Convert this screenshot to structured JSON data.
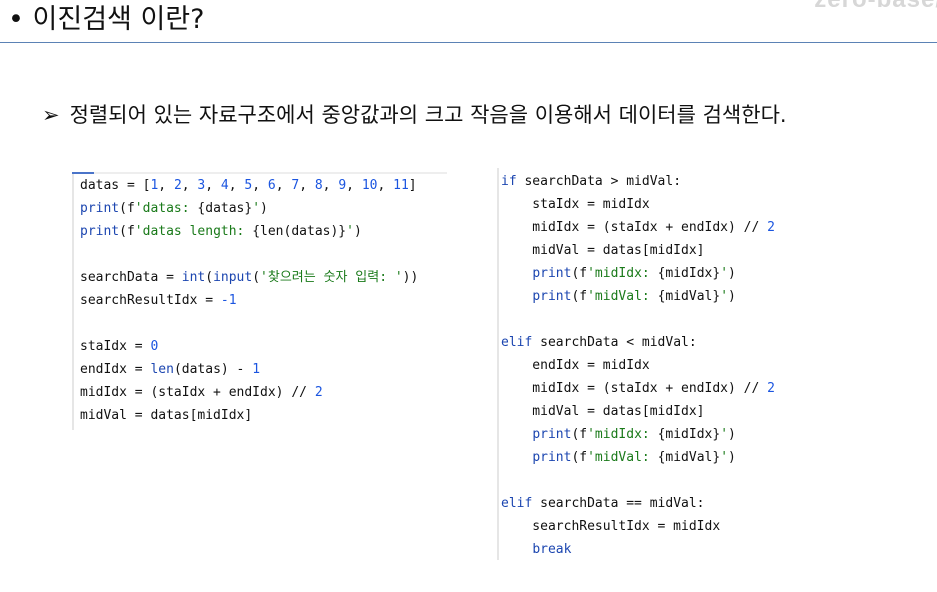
{
  "header": {
    "title": "• 이진검색 이란?",
    "watermark": "zero-base/"
  },
  "subtitle": {
    "arrow": "➢",
    "text": "정렬되어 있는 자료구조에서 중앙값과의 크고 작음을 이용해서 데이터를 검색한다."
  },
  "code_left": [
    "datas = [1, 2, 3, 4, 5, 6, 7, 8, 9, 10, 11]",
    "print(f'datas: {datas}')",
    "print(f'datas length: {len(datas)}')",
    "",
    "searchData = int(input('찾으려는 숫자 입력: '))",
    "searchResultIdx = -1",
    "",
    "staIdx = 0",
    "endIdx = len(datas) - 1",
    "midIdx = (staIdx + endIdx) // 2",
    "midVal = datas[midIdx]"
  ],
  "code_right": [
    "if searchData > midVal:",
    "    staIdx = midIdx",
    "    midIdx = (staIdx + endIdx) // 2",
    "    midVal = datas[midIdx]",
    "    print(f'midIdx: {midIdx}')",
    "    print(f'midVal: {midVal}')",
    "",
    "elif searchData < midVal:",
    "    endIdx = midIdx",
    "    midIdx = (staIdx + endIdx) // 2",
    "    midVal = datas[midIdx]",
    "    print(f'midIdx: {midIdx}')",
    "    print(f'midVal: {midVal}')",
    "",
    "elif searchData == midVal:",
    "    searchResultIdx = midIdx",
    "    break"
  ],
  "colors": {
    "keyword": "#1c46b0",
    "number": "#1b55e0",
    "string": "#1a7a1a",
    "rule": "#5b82b5"
  }
}
